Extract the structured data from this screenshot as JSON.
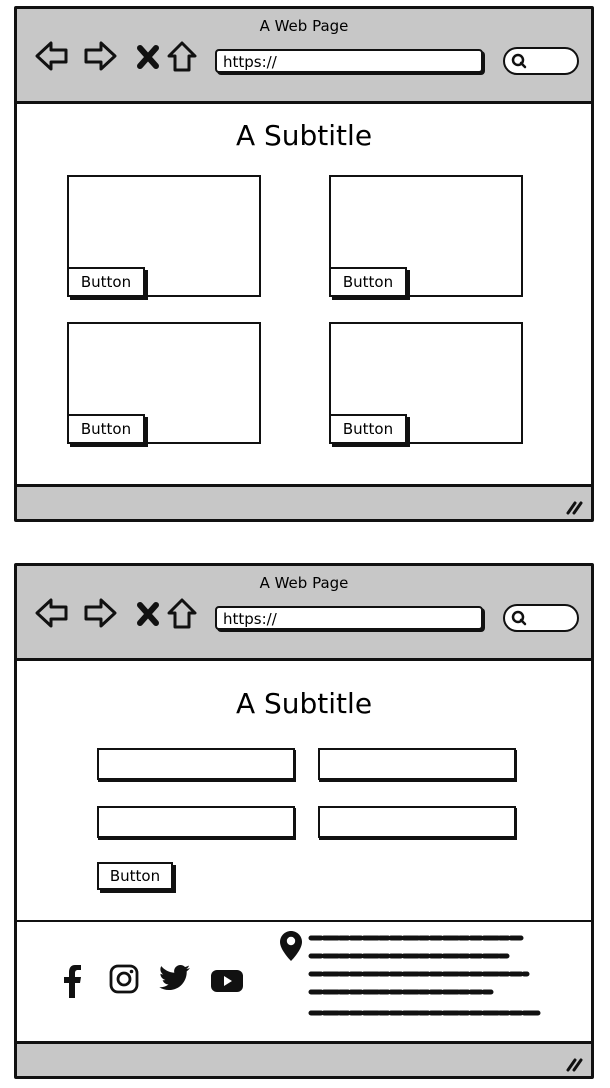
{
  "window_top": {
    "title": "A Web Page",
    "url": "https://",
    "subtitle": "A Subtitle",
    "cards": [
      {
        "button_label": "Button"
      },
      {
        "button_label": "Button"
      },
      {
        "button_label": "Button"
      },
      {
        "button_label": "Button"
      }
    ]
  },
  "window_bottom": {
    "title": "A Web Page",
    "url": "https://",
    "subtitle": "A Subtitle",
    "form_button_label": "Button",
    "footer": {
      "social_icons": [
        "facebook-icon",
        "instagram-icon",
        "twitter-icon",
        "youtube-icon"
      ],
      "location_icon": "map-pin-icon"
    }
  }
}
